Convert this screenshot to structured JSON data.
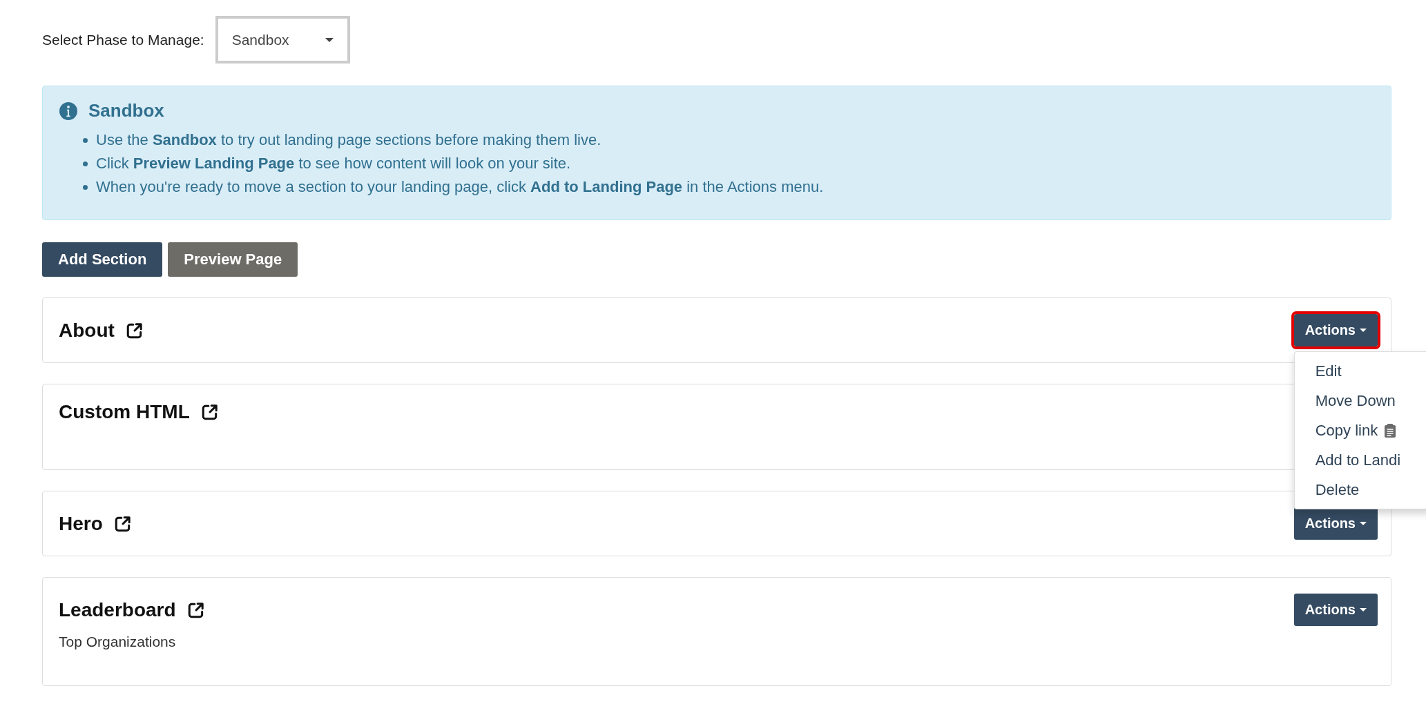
{
  "phase_selector": {
    "label": "Select Phase to Manage:",
    "value": "Sandbox"
  },
  "info": {
    "title": "Sandbox",
    "items": [
      "Use the **Sandbox** to try out landing page sections before making them live.",
      "Click **Preview Landing Page** to see how content will look on your site.",
      "When you're ready to move a section to your landing page, click **Add to Landing Page** in the Actions menu."
    ]
  },
  "buttons": [
    {
      "label": "Add Section",
      "kind": "primary"
    },
    {
      "label": "Preview Page",
      "kind": "secondary"
    }
  ],
  "sections": [
    {
      "title": "About",
      "actions": "Actions",
      "expanded": true,
      "menu": [
        {
          "label": "Edit"
        },
        {
          "label": "Move Down"
        },
        {
          "label": "Copy link",
          "kind": "copy"
        },
        {
          "label": "Add to Landi"
        },
        {
          "label": "Delete"
        }
      ]
    },
    {
      "title": "Custom HTML"
    },
    {
      "title": "Hero",
      "actions": "Actions"
    },
    {
      "title": "Leaderboard",
      "actions": "Actions",
      "description": "Top Organizations"
    }
  ]
}
